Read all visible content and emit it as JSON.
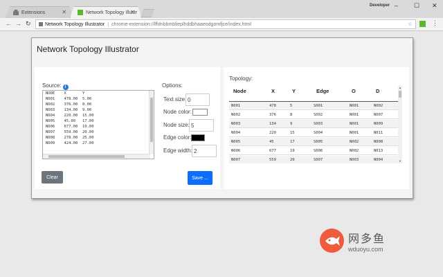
{
  "browser": {
    "tabs": [
      {
        "label": "Extensions",
        "active": false
      },
      {
        "label": "Network Topology Illustr",
        "active": true
      }
    ],
    "profile": "Developer",
    "address": {
      "site": "Network Topology Illustrator",
      "url": "chrome-extension://lffdnbbmblieplhddbhaaeodgomfjce/index.html"
    }
  },
  "app": {
    "title": "Network Topology Illustrator",
    "source": {
      "label": "Source:",
      "rows": [
        "NODE    X       Y",
        "N001    478.00  5.00",
        "N002    376.00  8.00",
        "N003    134.00  9.00",
        "N004    220.00  15.00",
        "N005    45.00   17.00",
        "N006    677.00  19.00",
        "N007    559.00  20.00",
        "N008    278.00  25.00",
        "N009    424.00  27.00"
      ]
    },
    "options": {
      "label": "Options:",
      "text_size_label": "Text size:",
      "text_size_value": "0",
      "node_color_label": "Node color:",
      "node_color_value": "#ffffff",
      "node_size_label": "Node size:",
      "node_size_value": "5",
      "edge_color_label": "Edge color:",
      "edge_color_value": "#000000",
      "edge_width_label": "Edge width:",
      "edge_width_value": "2"
    },
    "buttons": {
      "clear": "Clear",
      "save": "Save ..."
    },
    "topology": {
      "label": "Topology:",
      "headers": [
        "Node",
        "X",
        "Y",
        "Edge",
        "O",
        "D"
      ],
      "rows": [
        [
          "N001",
          "478",
          "5",
          "S001",
          "N001",
          "N002"
        ],
        [
          "N002",
          "376",
          "8",
          "S002",
          "N001",
          "N007"
        ],
        [
          "N003",
          "134",
          "9",
          "S003",
          "N001",
          "N009"
        ],
        [
          "N004",
          "220",
          "15",
          "S004",
          "N001",
          "N011"
        ],
        [
          "N005",
          "45",
          "17",
          "S005",
          "N002",
          "N008"
        ],
        [
          "N006",
          "677",
          "19",
          "S006",
          "N002",
          "N013"
        ],
        [
          "N007",
          "559",
          "20",
          "S007",
          "N003",
          "N004"
        ]
      ]
    }
  },
  "watermark": {
    "cn": "网多鱼",
    "url": "wduoyu.com"
  },
  "colors": {
    "primary": "#0d6efd",
    "secondary": "#6c757d",
    "info": "#2a79d6"
  }
}
